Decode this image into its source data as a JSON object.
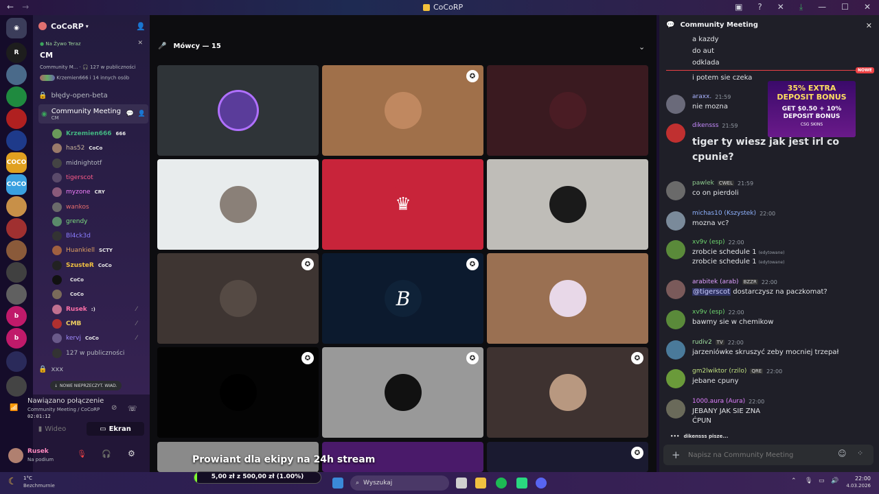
{
  "window": {
    "title": "CoCoRP"
  },
  "server": {
    "name": "CoCoRP"
  },
  "live": {
    "label": "Na Żywo Teraz",
    "title": "CM",
    "subtitle": "Community M...",
    "listeners": "127 w publiczności",
    "people": "Krzemien666 i 14 innych osób"
  },
  "channels": [
    {
      "name": "błędy-open-beta"
    },
    {
      "name": "Community Meeting",
      "sub": "CM"
    }
  ],
  "members": [
    {
      "name": "Krzemien666",
      "tag": "666",
      "color": "#43b581"
    },
    {
      "name": "has52",
      "tag": "CoCo",
      "color": "#c9b49a"
    },
    {
      "name": "midnightotf",
      "tag": "",
      "color": "#b5bac1"
    },
    {
      "name": "tigerscot",
      "tag": "",
      "color": "#ff5c8a"
    },
    {
      "name": "myzone",
      "tag": "CRY",
      "color": "#f47fff"
    },
    {
      "name": "wankos",
      "tag": "",
      "color": "#e86d6d"
    },
    {
      "name": "grendy",
      "tag": "",
      "color": "#7ee081"
    },
    {
      "name": "Bl4ck3d",
      "tag": "",
      "color": "#8a7dff"
    },
    {
      "name": "Huankiell",
      "tag": "SCTY",
      "color": "#e0a060"
    },
    {
      "name": "SzusteR",
      "tag": "CoCo",
      "color": "#f0c040"
    },
    {
      "name": "",
      "tag": "CoCo",
      "color": "#b5bac1"
    },
    {
      "name": "",
      "tag": "CoCo",
      "color": "#b5bac1"
    },
    {
      "name": "Rusek",
      "tag": ":)",
      "color": "#ff6fa8"
    },
    {
      "name": "CMB",
      "tag": "",
      "color": "#f0d060"
    },
    {
      "name": "kervj",
      "tag": "CoCo",
      "color": "#a08cff"
    },
    {
      "name": "127 w publiczności",
      "tag": "",
      "color": "#b5bac1"
    }
  ],
  "xxx_channel": "xxx",
  "unread_pill": "NOWE NIEPRZECZYT. WIAD.",
  "voice": {
    "status": "Nawiązano połączenie",
    "where": "Community Meeting / CoCoRP",
    "time": "02:01:12",
    "video": "Wideo",
    "screen": "Ekran"
  },
  "user": {
    "name": "Rusek",
    "status": "Na podium"
  },
  "stage": {
    "speakers": "Mówcy — 15",
    "overlay_title": "Prowiant dla ekipy na 24h stream",
    "goal": "5,00 zł z 500,00 zł (1.00%)",
    "goal_fraction": 0.01
  },
  "tiles": [
    {
      "bg": "#2f3438",
      "pic": "#5a3c9a",
      "mod": false
    },
    {
      "bg": "#a0704a",
      "pic": "#c08860",
      "mod": true
    },
    {
      "bg": "#3a1a20",
      "pic": "#4a1c24",
      "mod": false
    },
    {
      "bg": "#e8eced",
      "pic": "#8a8078",
      "mod": false
    },
    {
      "bg": "#c8243a",
      "pic": "#c8243a",
      "mod": false
    },
    {
      "bg": "#bfbdb8",
      "pic": "#1a1a1a",
      "mod": false
    },
    {
      "bg": "#3e3532",
      "pic": "#554a44",
      "mod": true
    },
    {
      "bg": "#0c1a2e",
      "pic": "#0f2238",
      "mod": true
    },
    {
      "bg": "#9a7052",
      "pic": "#e8d8e8",
      "mod": false
    },
    {
      "bg": "#040404",
      "pic": "#000000",
      "mod": true
    },
    {
      "bg": "#999999",
      "pic": "#111111",
      "mod": true
    },
    {
      "bg": "#3e3230",
      "pic": "#b89880",
      "mod": true
    }
  ],
  "chat": {
    "title": "Community Meeting",
    "top_lines": [
      "a kazdy",
      "do aut",
      "odklada",
      "i potem sie czeka"
    ],
    "new_badge": "NOWE",
    "ad_line1": "35% EXTRA DEPOSIT BONUS",
    "ad_line2": "GET $0.50 + 10% DEPOSIT BONUS",
    "ad_brand": "CSG SKINS",
    "messages": [
      {
        "user": "araxx.",
        "time": "21:59",
        "text": "nie mozna",
        "color": "#aab4ff"
      },
      {
        "user": "dikensss",
        "time": "21:59",
        "text": "tiger ty wiesz jak jest irl co",
        "text2": "cpunie?",
        "color": "#c78cff",
        "big": true
      },
      {
        "user": "pawlek",
        "badge": "CWEL",
        "time": "21:59",
        "text": "co on pierdoli",
        "color": "#8ecb8e"
      },
      {
        "user": "michas10 (Kszystek)",
        "time": "22:00",
        "text": "mozna vc?",
        "color": "#8fb3ff"
      },
      {
        "user": "xv9v (esp)",
        "time": "22:00",
        "text": "zrobcie schedule 1",
        "text2": "zrobcie schedule 1",
        "edited": "(edytowane)",
        "color": "#6ed66e"
      },
      {
        "user": "arabitek (arab)",
        "badge": "BZZR",
        "time": "22:00",
        "mention": "@tigerscot",
        "text": "dostarczysz na paczkomat?",
        "color": "#e0a0ff"
      },
      {
        "user": "xv9v (esp)",
        "time": "22:00",
        "text": "bawmy sie w chemikow",
        "color": "#6ed66e"
      },
      {
        "user": "rudiv2",
        "badge": "TV",
        "time": "22:00",
        "text": "jarzeniówke skruszyć zeby mocniej trzepał",
        "color": "#a0e0a0"
      },
      {
        "user": "gm2lwiktor (rzilo)",
        "badge": "QRE",
        "time": "22:00",
        "text": "jebane cpuny",
        "color": "#c0e080"
      },
      {
        "user": "1000.aura (Aura)",
        "time": "22:00",
        "text": "JEBANY JAK SIE ZNA",
        "text2": "ĆPUN",
        "color": "#e080ff"
      }
    ],
    "typing": "dikensss pisze...",
    "input_placeholder": "Napisz na Community Meeting"
  },
  "taskbar": {
    "weather_temp": "1°C",
    "weather_desc": "Bezchmurnie",
    "search": "Wyszukaj",
    "time": "22:00",
    "date": "4.03.2026"
  }
}
